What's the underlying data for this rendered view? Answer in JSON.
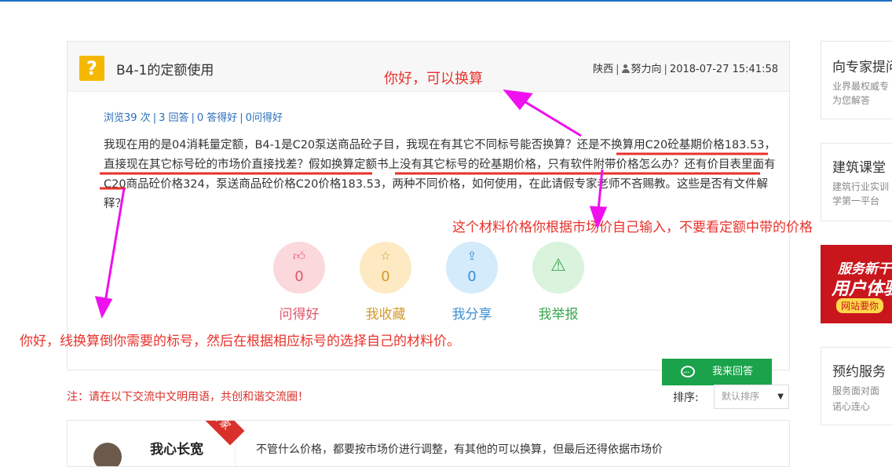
{
  "question": {
    "title": "B4-1的定额使用",
    "icon": "question-mark-icon",
    "meta": {
      "region": "陕西",
      "author": "努力向",
      "datetime": "2018-07-27 15:41:58"
    },
    "stats": {
      "views": "浏览39 次",
      "answers": "3 回答",
      "good": "0 答得好",
      "asked_good": "0问得好"
    },
    "body": "我现在用的是04消耗量定额，B4-1是C20泵送商品砼子目，我现在有其它不同标号能否换算？还是不换算用C20砼基期价格183.53，直接现在其它标号砼的市场价直接找差？假如换算定额书上没有其它标号的砼基期价格，只有软件附带价格怎么办？还有价目表里面有C20商品砼价格324，泵送商品砼价格C20价格183.53，两种不同价格，如何使用，在此请假专家老师不吝赐教。这些是否有文件解释？"
  },
  "actions": [
    {
      "icon": "thumbs-up-icon",
      "count": "0",
      "label": "问得好",
      "bg": "#fbd8dc",
      "fg": "#e0566a"
    },
    {
      "icon": "star-icon",
      "count": "0",
      "label": "我收藏",
      "bg": "#fdeac3",
      "fg": "#d49a2a"
    },
    {
      "icon": "share-icon",
      "count": "0",
      "label": "我分享",
      "bg": "#d3ebfa",
      "fg": "#3a8fd6"
    },
    {
      "icon": "warning-icon",
      "count": "",
      "label": "我举报",
      "bg": "#d9f3dd",
      "fg": "#3aa54e"
    }
  ],
  "answer_button": {
    "label": "我来回答"
  },
  "note": "注：请在以下交流中文明用语，共创和谐交流圈！",
  "sort": {
    "label": "排序:",
    "selected": "默认排序"
  },
  "answer": {
    "name": "我心长宽",
    "tag": "专家",
    "text": "不管什么价格，都要按市场价进行调整，有其他的可以换算，但最后还得依据市场价"
  },
  "sidebar": {
    "box1": {
      "title": "向专家提问",
      "sub1": "业界最权威专",
      "sub2": "为您解答"
    },
    "box2": {
      "title": "建筑课堂",
      "sub1": "建筑行业实训",
      "sub2": "学第一平台"
    },
    "promo": {
      "line1": "服务新干",
      "line2": "用户体验",
      "line3": "网站要你"
    },
    "box3": {
      "title": "预约服务",
      "sub1": "服务面对面",
      "sub2": "诺心连心"
    }
  },
  "annotations": {
    "a1": "你好，可以换算",
    "a2": "这个材料价格你根据市场价自己输入，不要看定额中带的价格",
    "a3": "你好，线换算倒你需要的标号，然后在根据相应标号的选择自己的材料价。"
  },
  "colors": {
    "accent_blue": "#2a6ebb",
    "answer_green": "#1aa34a",
    "note_red": "#d9302b",
    "annotation_red": "#e8322b",
    "arrow_magenta": "#ee10ee"
  }
}
